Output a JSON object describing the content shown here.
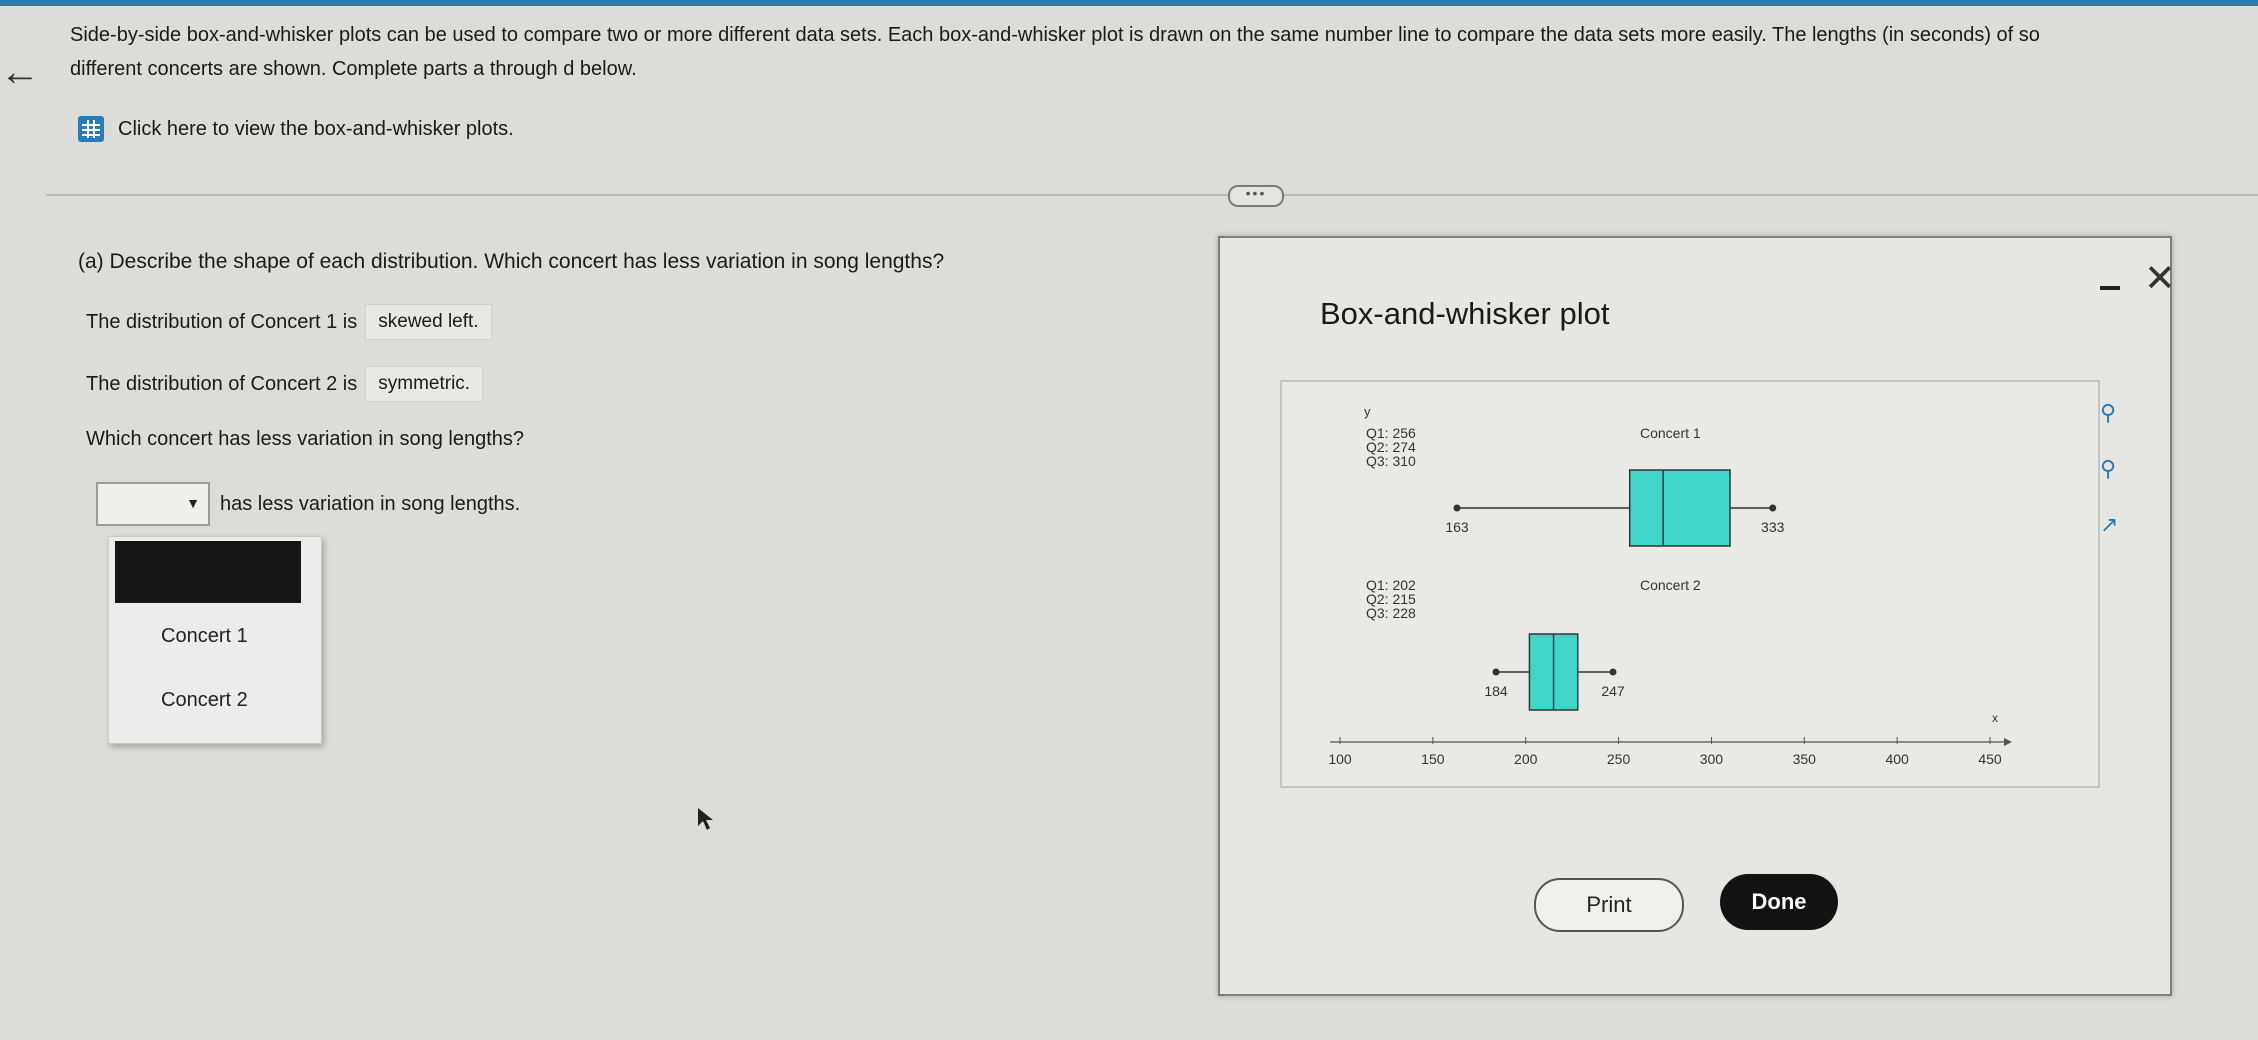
{
  "intro_text": "Side-by-side box-and-whisker plots can be used to compare two or more different data sets. Each box-and-whisker plot is drawn on the same number line to compare the data sets more easily. The lengths (in seconds) of so",
  "intro_text_2": "different concerts are shown. Complete parts a through d below.",
  "view_link": "Click here to view the box-and-whisker plots.",
  "question": "(a) Describe the shape of each distribution. Which concert has less variation in song lengths?",
  "line1_prefix": "The distribution of Concert 1 is",
  "line1_answer": "skewed left.",
  "line2_prefix": "The distribution of Concert 2 is",
  "line2_answer": "symmetric.",
  "line3": "Which concert has less variation in song lengths?",
  "line4_suffix": "has less variation in song lengths.",
  "dropdown_options": [
    "Concert 1",
    "Concert 2"
  ],
  "dialog": {
    "title": "Box-and-whisker plot",
    "print_label": "Print",
    "done_label": "Done"
  },
  "chart_data": {
    "type": "boxplot",
    "y_axis_label": "y",
    "x_axis_label": "x",
    "x_ticks": [
      100,
      150,
      200,
      250,
      300,
      350,
      400,
      450
    ],
    "xlim": [
      100,
      450
    ],
    "series": [
      {
        "name": "Concert 1",
        "min": 163,
        "q1": 256,
        "q2": 274,
        "q3": 310,
        "max": 333,
        "label_q1": "Q1: 256",
        "label_q2": "Q2: 274",
        "label_q3": "Q3: 310",
        "label_min": "163",
        "label_max": "333"
      },
      {
        "name": "Concert 2",
        "min": 184,
        "q1": 202,
        "q2": 215,
        "q3": 228,
        "max": 247,
        "label_q1": "Q1: 202",
        "label_q2": "Q2: 215",
        "label_q3": "Q3: 228",
        "label_min": "184",
        "label_max": "247"
      }
    ],
    "box_color": "#40d6cc"
  }
}
